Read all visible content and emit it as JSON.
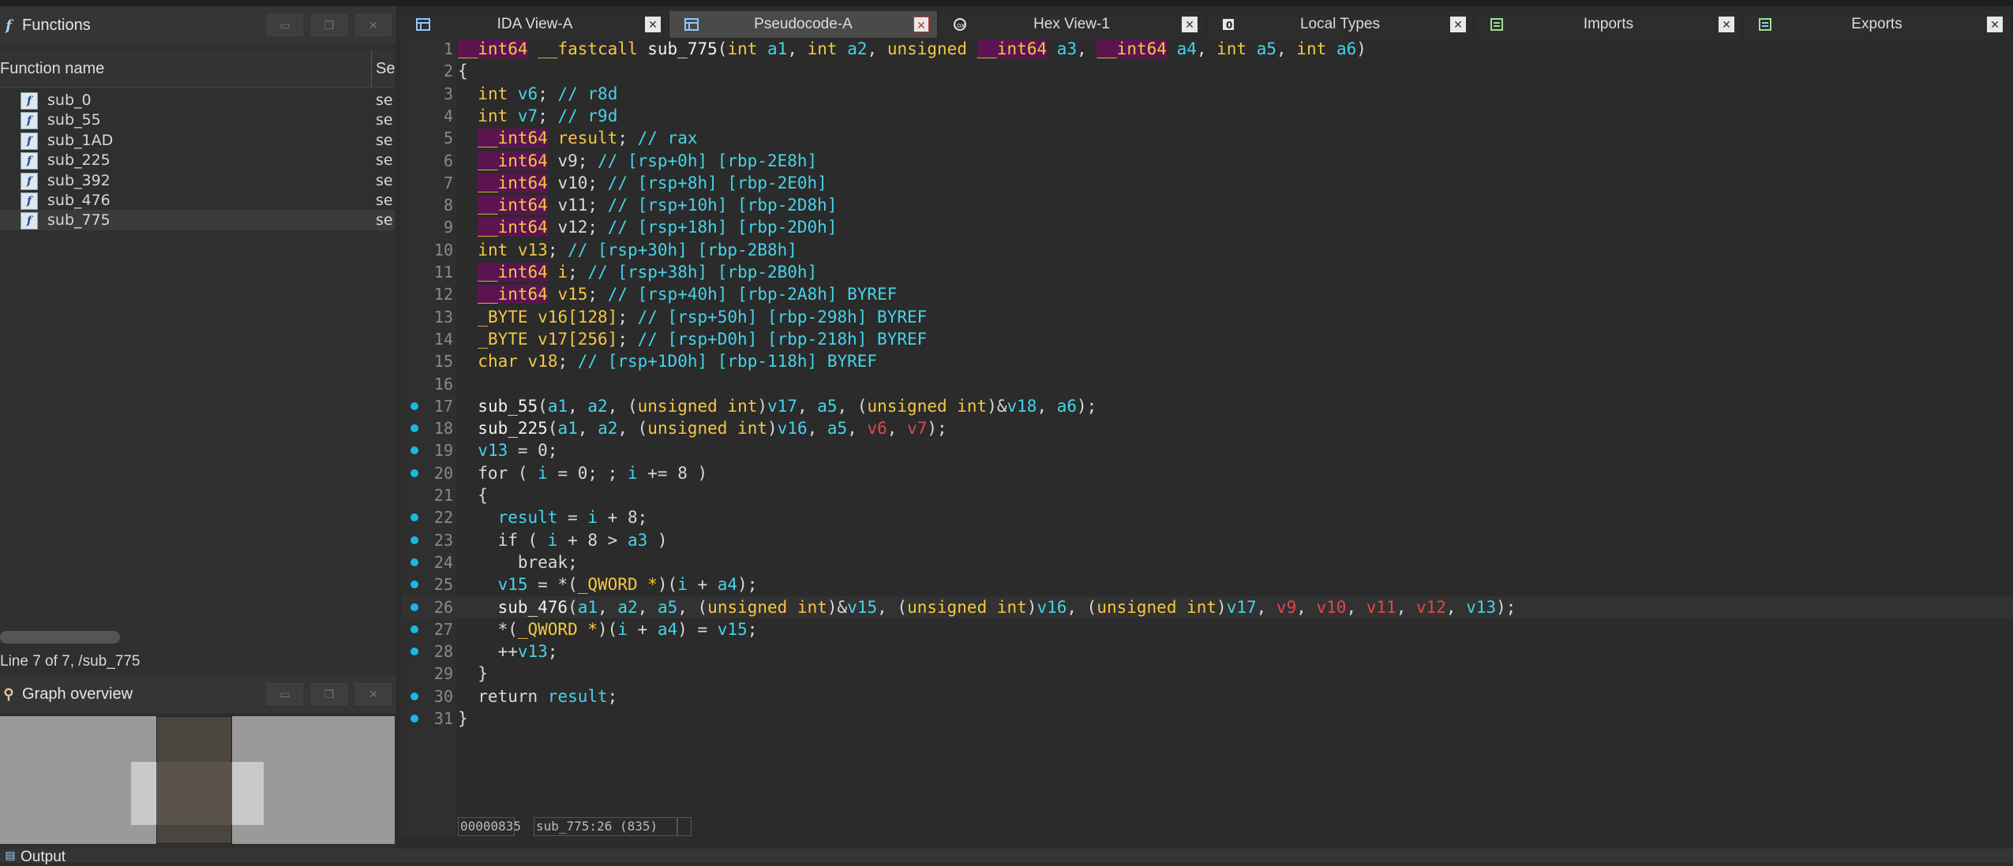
{
  "functions_panel": {
    "title": "Functions",
    "col_name": "Function name",
    "col_segment": "Se",
    "items": [
      {
        "name": "sub_0",
        "seg": "se"
      },
      {
        "name": "sub_55",
        "seg": "se"
      },
      {
        "name": "sub_1AD",
        "seg": "se"
      },
      {
        "name": "sub_225",
        "seg": "se"
      },
      {
        "name": "sub_392",
        "seg": "se"
      },
      {
        "name": "sub_476",
        "seg": "se"
      },
      {
        "name": "sub_775",
        "seg": "se"
      }
    ],
    "status": "Line 7 of 7, /sub_775"
  },
  "graph_panel": {
    "title": "Graph overview"
  },
  "tabs": [
    {
      "label": "IDA View-A"
    },
    {
      "label": "Pseudocode-A"
    },
    {
      "label": "Hex View-1"
    },
    {
      "label": "Local Types"
    },
    {
      "label": "Imports"
    },
    {
      "label": "Exports"
    }
  ],
  "editor": {
    "status_address": "00000835",
    "status_location": "sub_775:26 (835)"
  },
  "output_panel": {
    "title": "Output"
  },
  "colors": {
    "keyword": "#f5c742",
    "highlight_bg": "#5c1451",
    "variable": "#44d4ea",
    "register_var": "#e04848",
    "breakpoint_dot": "#19b7e8"
  }
}
